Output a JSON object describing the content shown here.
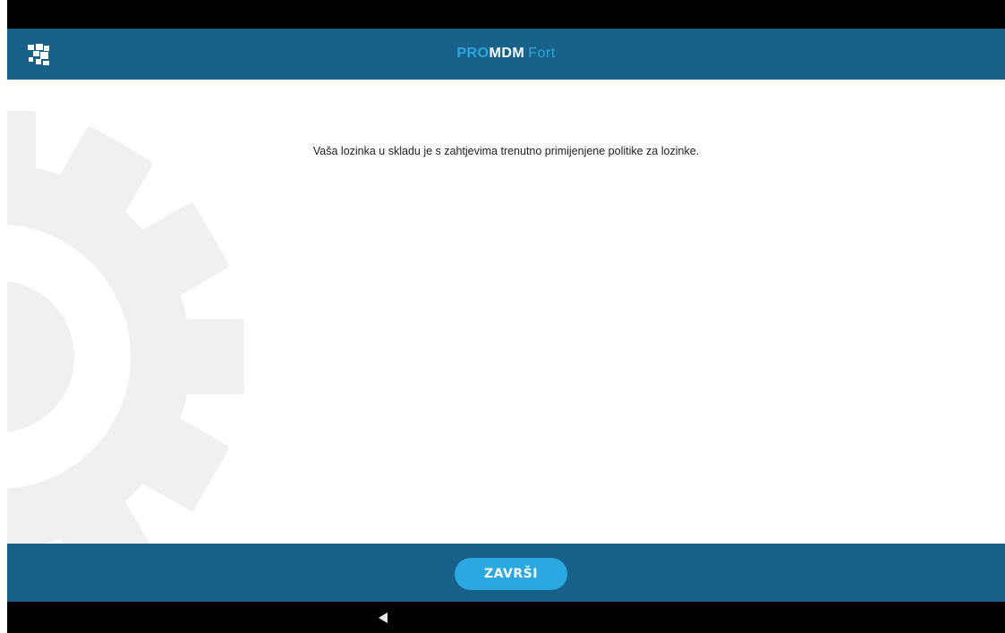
{
  "header": {
    "logo_icon": "puzzle-icon",
    "brand": {
      "pro": "PRO",
      "mdm": "MDM",
      "fort": "Fort"
    }
  },
  "main": {
    "message": "Vaša lozinka u skladu je s zahtjevima trenutno primijenjene politike za lozinke.",
    "background_icon": "gear-icon"
  },
  "footer": {
    "finish_label": "ZAVRŠI"
  },
  "navigation": {
    "back_icon": "back-triangle-icon"
  },
  "colors": {
    "header_bg": "#186189",
    "accent": "#2aa8e0",
    "gear": "#f0f0f0"
  }
}
